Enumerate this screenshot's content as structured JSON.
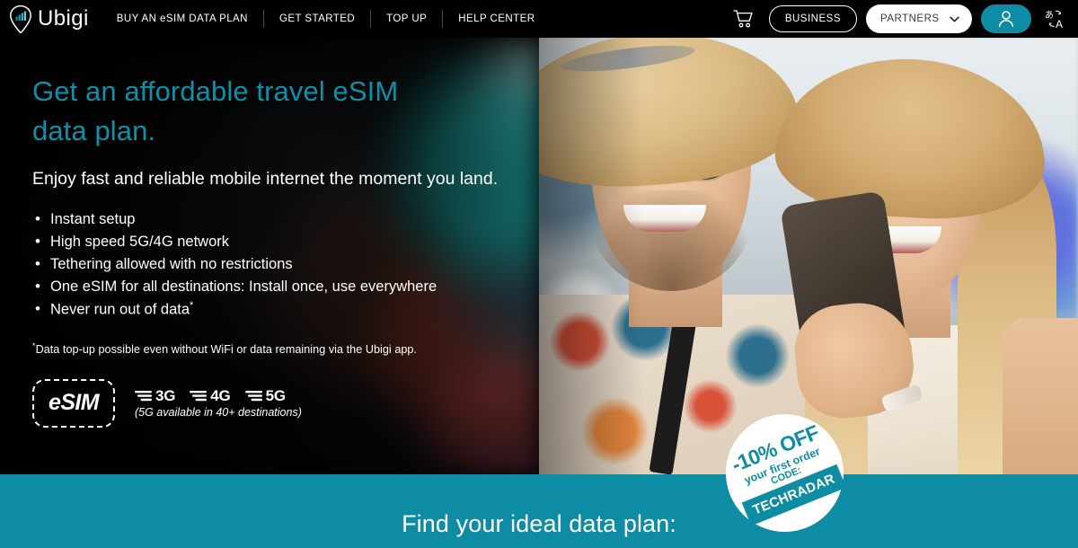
{
  "header": {
    "logo": {
      "brand": "Ubigi",
      "icon": "location-pin-signal-icon"
    },
    "nav": [
      {
        "label": "BUY AN eSIM DATA PLAN"
      },
      {
        "label": "GET STARTED"
      },
      {
        "label": "TOP UP"
      },
      {
        "label": "HELP CENTER"
      }
    ],
    "cart_icon": "shopping-cart-icon",
    "business_label": "BUSINESS",
    "partners_label": "PARTNERS",
    "partners_chevron": "chevron-down-icon",
    "account_icon": "user-account-icon",
    "language_icon": "language-translate-icon"
  },
  "hero": {
    "heading_line1": "Get an affordable travel eSIM",
    "heading_line2": "data plan.",
    "subheading": "Enjoy fast and reliable mobile internet the moment you land.",
    "bullets": [
      "Instant setup",
      "High speed 5G/4G network",
      "Tethering allowed with no restrictions",
      "One eSIM for all destinations: Install once, use everywhere",
      "Never run out of data"
    ],
    "bullet_superscript": "*",
    "footnote_star": "*",
    "footnote": "Data top-up possible even without WiFi or data remaining via the Ubigi app.",
    "esim_badge": "eSIM",
    "networks": [
      {
        "label": "3G",
        "icon": "signal-bars-icon"
      },
      {
        "label": "4G",
        "icon": "signal-bars-icon"
      },
      {
        "label": "5G",
        "icon": "signal-bars-icon"
      }
    ],
    "networks_note": "(5G available in 40+ destinations)",
    "photo_alt": "couple-in-straw-hats-airport-photo"
  },
  "promo": {
    "discount": "-10% OFF",
    "line2": "your first order",
    "line3": "CODE:",
    "code": "TECHRADAR"
  },
  "band": {
    "title": "Find your ideal data plan:"
  },
  "colors": {
    "teal": "#0d8ca4",
    "heading_teal": "#0f8fa8",
    "black": "#000000",
    "white": "#ffffff"
  }
}
